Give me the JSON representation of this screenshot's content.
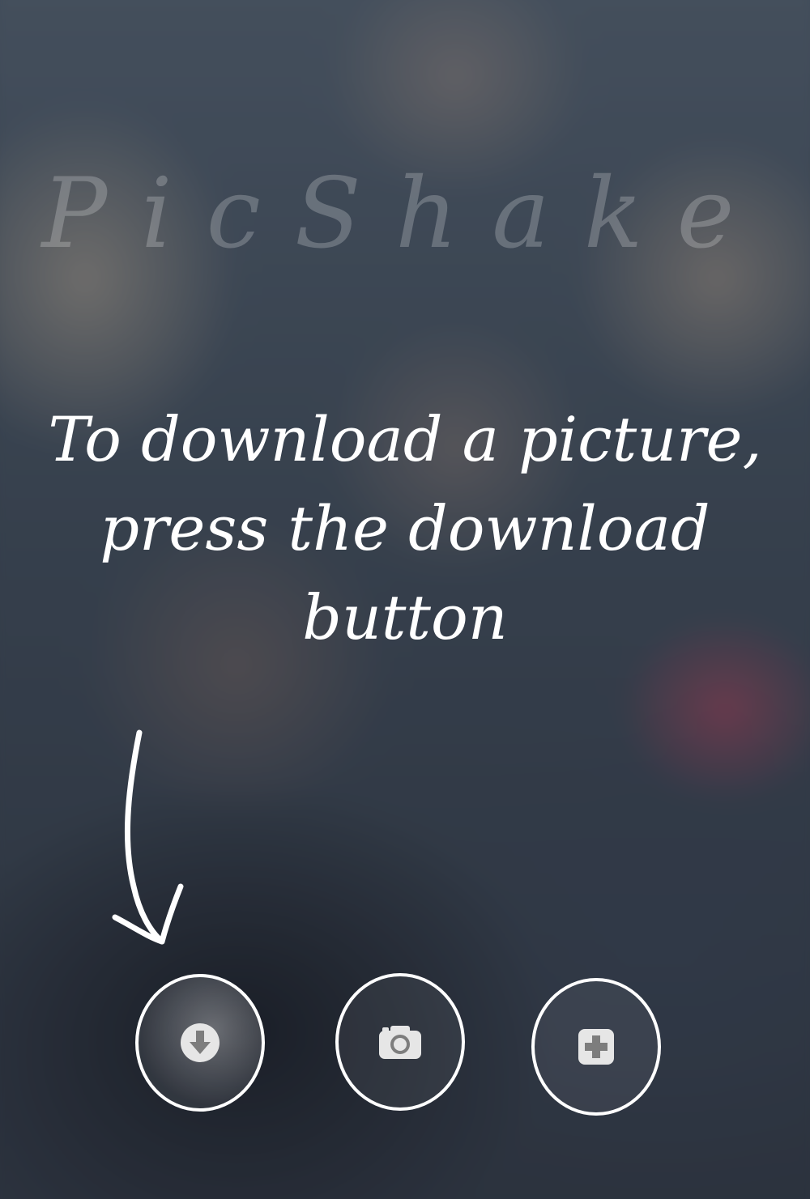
{
  "app": {
    "watermark": "PicShake"
  },
  "instruction": {
    "line1": "To download a picture,",
    "line2": "press the download",
    "line3": "button"
  },
  "buttons": {
    "download": {
      "icon": "download-arrow-icon"
    },
    "camera": {
      "icon": "camera-icon"
    },
    "add": {
      "icon": "plus-square-icon"
    }
  },
  "colors": {
    "text": "#ffffff",
    "icon": "#e6e6e6"
  }
}
